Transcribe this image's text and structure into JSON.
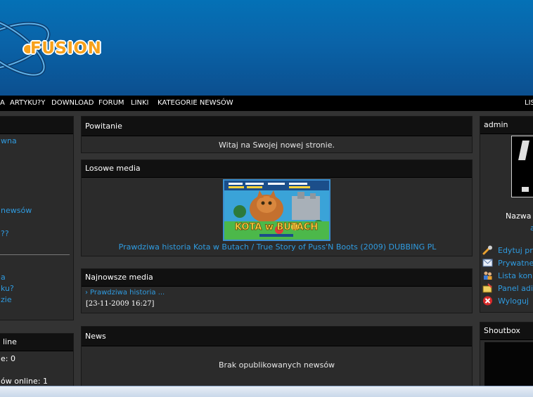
{
  "logo": {
    "text": "FUSION"
  },
  "nav": {
    "items": [
      "A",
      "ARTYKU?Y",
      "DOWNLOAD",
      "FORUM",
      "LINKI",
      "KATEGORIE NEWSÓW"
    ],
    "right": "LIS"
  },
  "left_sidebar": {
    "links_group1": [
      "wna",
      "newsów",
      "??"
    ],
    "links_group2": [
      "a",
      "ku?",
      "zie"
    ],
    "online_panel": {
      "title": "line",
      "line1": "e: 0",
      "line2": "ów online: 1"
    }
  },
  "welcome": {
    "title": "Powitanie",
    "text": "Witaj na Swojej nowej stronie."
  },
  "random_media": {
    "title": "Losowe media",
    "poster_title": "KOTA w BUTACH",
    "caption": "Prawdziwa historia Kota w Butach / True Story of Puss'N Boots (2009) DUBBING PL"
  },
  "latest_media": {
    "title": "Najnowsze media",
    "item_link": "Prawdziwa historia ...",
    "item_date": "[23-11-2009 16:27]"
  },
  "news": {
    "title": "News",
    "empty_text": "Brak opublikowanych newsów"
  },
  "user_panel": {
    "title": "admin",
    "name_label": "Nazwa",
    "name_value": "a",
    "menu": [
      "Edytuj pro",
      "Prywatne",
      "Lista kon",
      "Panel adi",
      "Wyloguj"
    ]
  },
  "shoutbox": {
    "title": "Shoutbox"
  },
  "colors": {
    "link": "#2f9be0",
    "accent": "#f7a11b",
    "header_bg": "#111111"
  }
}
